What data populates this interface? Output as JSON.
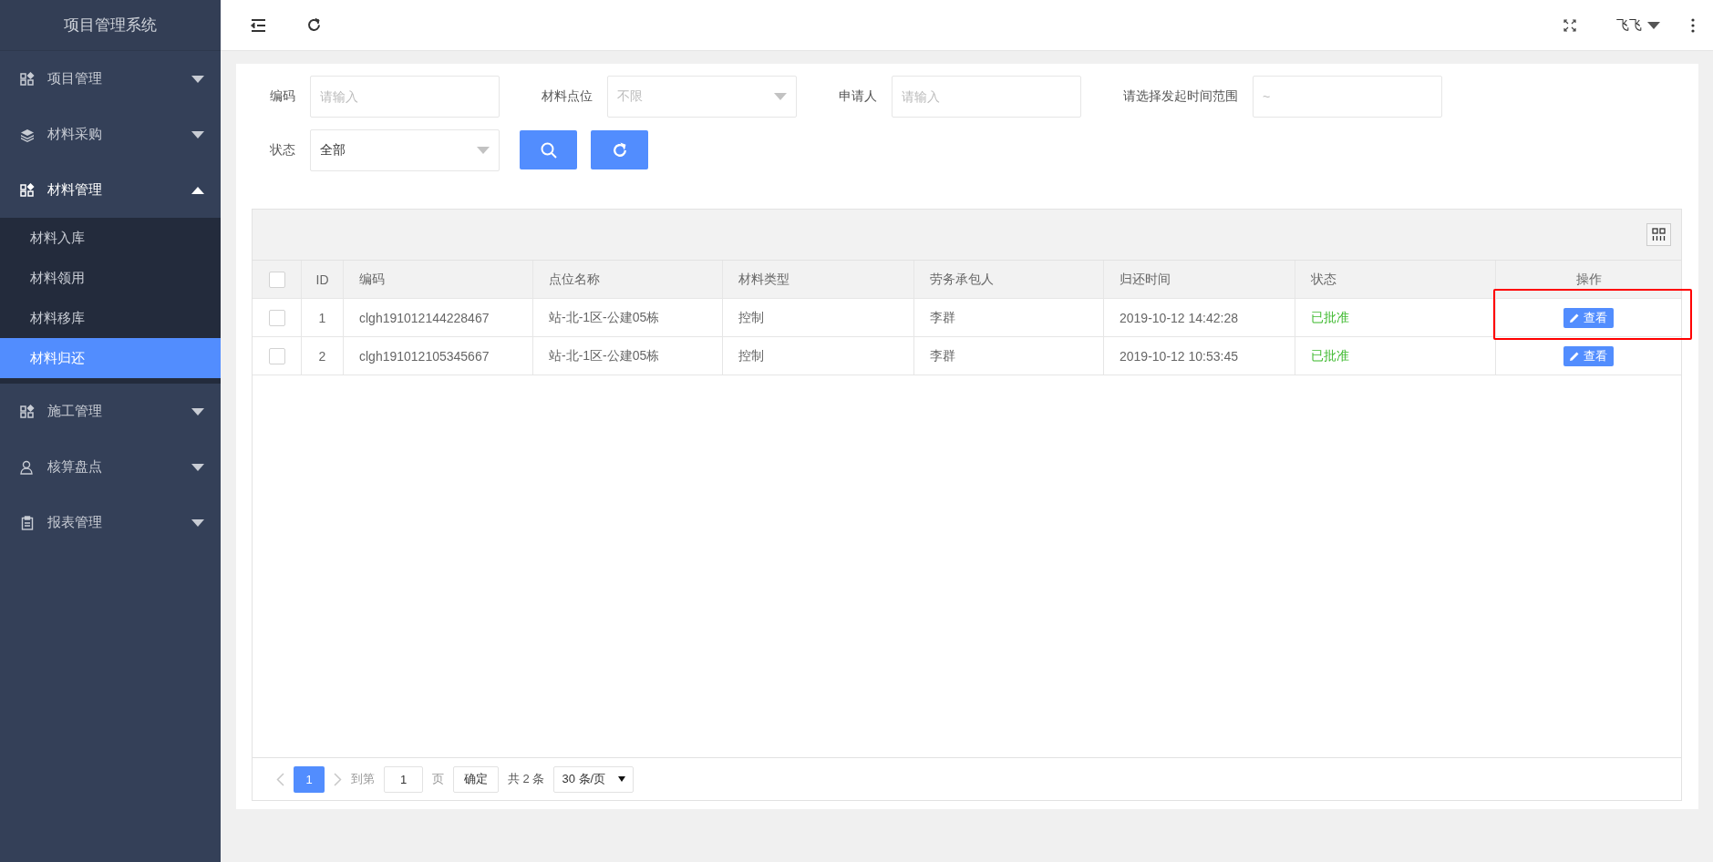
{
  "sidebar": {
    "title": "项目管理系统",
    "items": [
      {
        "label": "项目管理",
        "kind": "grid",
        "expanded": false
      },
      {
        "label": "材料采购",
        "kind": "layers",
        "expanded": false
      },
      {
        "label": "材料管理",
        "kind": "grid",
        "expanded": true,
        "children": [
          {
            "label": "材料入库",
            "selected": false
          },
          {
            "label": "材料领用",
            "selected": false
          },
          {
            "label": "材料移库",
            "selected": false
          },
          {
            "label": "材料归还",
            "selected": true
          }
        ]
      },
      {
        "label": "施工管理",
        "kind": "grid",
        "expanded": false
      },
      {
        "label": "核算盘点",
        "kind": "user",
        "expanded": false
      },
      {
        "label": "报表管理",
        "kind": "clipboard",
        "expanded": false
      }
    ]
  },
  "topbar": {
    "user": "飞飞"
  },
  "filters": [
    {
      "label": "编码",
      "kind": "input",
      "placeholder": "请输入"
    },
    {
      "label": "材料点位",
      "kind": "select",
      "placeholder": "不限"
    },
    {
      "label": "申请人",
      "kind": "input",
      "placeholder": "请输入"
    },
    {
      "label": "请选择发起时间范围",
      "kind": "range",
      "placeholder": "~"
    },
    {
      "label": "状态",
      "kind": "select",
      "value": "全部"
    }
  ],
  "table": {
    "all_checked": false,
    "columns": [
      "ID",
      "编码",
      "点位名称",
      "材料类型",
      "劳务承包人",
      "归还时间",
      "状态",
      "操作"
    ],
    "rows": [
      {
        "checked": false,
        "highlighted": true,
        "cells": [
          "1",
          "clgh191012144228467",
          "站-北-1区-公建05栋",
          "控制",
          "李群",
          "2019-10-12 14:42:28",
          "已批准"
        ],
        "action": "查看"
      },
      {
        "checked": false,
        "highlighted": false,
        "cells": [
          "2",
          "clgh191012105345667",
          "站-北-1区-公建05栋",
          "控制",
          "李群",
          "2019-10-12 10:53:45",
          "已批准"
        ],
        "action": "查看"
      }
    ]
  },
  "pagination": {
    "pages": [
      {
        "label": "1",
        "selected": true
      }
    ],
    "goto_label": "到第",
    "page_input": "1",
    "page_unit": "页",
    "confirm": "确定",
    "total": "共 2 条",
    "page_size": "30 条/页"
  }
}
